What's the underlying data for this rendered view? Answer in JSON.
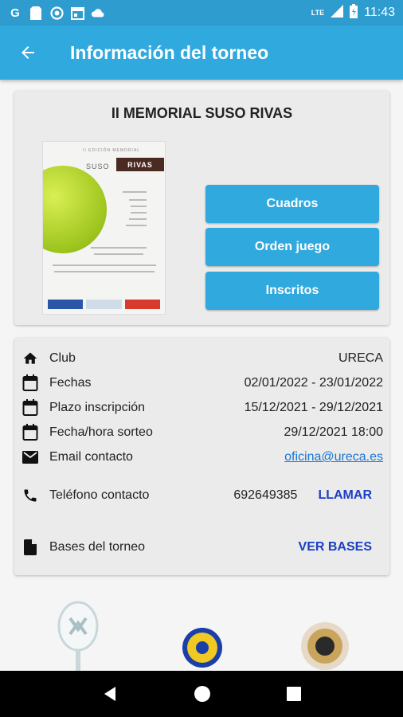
{
  "status_bar": {
    "time": "11:43",
    "network": "LTE",
    "left_icons": [
      "google-icon",
      "sim-card-icon",
      "circle-icon",
      "calendar-app-icon",
      "cloud-icon"
    ]
  },
  "app_bar": {
    "title": "Información del torneo",
    "background": "#2fa9de"
  },
  "tournament": {
    "name": "II MEMORIAL SUSO RIVAS",
    "poster": {
      "top_text": "II EDICIÓN MEMORIAL",
      "name_left": "SUSO",
      "name_right": "RIVAS"
    }
  },
  "actions": {
    "draws": "Cuadros",
    "order": "Orden juego",
    "registered": "Inscritos"
  },
  "info": {
    "club_label": "Club",
    "club_value": "URECA",
    "dates_label": "Fechas",
    "dates_value": "02/01/2022 - 23/01/2022",
    "registration_label": "Plazo inscripción",
    "registration_value": "15/12/2021 - 29/12/2021",
    "draw_label": "Fecha/hora sorteo",
    "draw_value": "29/12/2021 18:00",
    "email_label": "Email contacto",
    "email_value": "oficina@ureca.es",
    "phone_label": "Teléfono contacto",
    "phone_value": "692649385",
    "call_button": "LLAMAR",
    "rules_label": "Bases del torneo",
    "rules_button": "VER BASES"
  },
  "colors": {
    "primary": "#2fa9de",
    "status_bar": "#2f9ccf",
    "link": "#1976d2",
    "text_button": "#1a3fc4"
  }
}
